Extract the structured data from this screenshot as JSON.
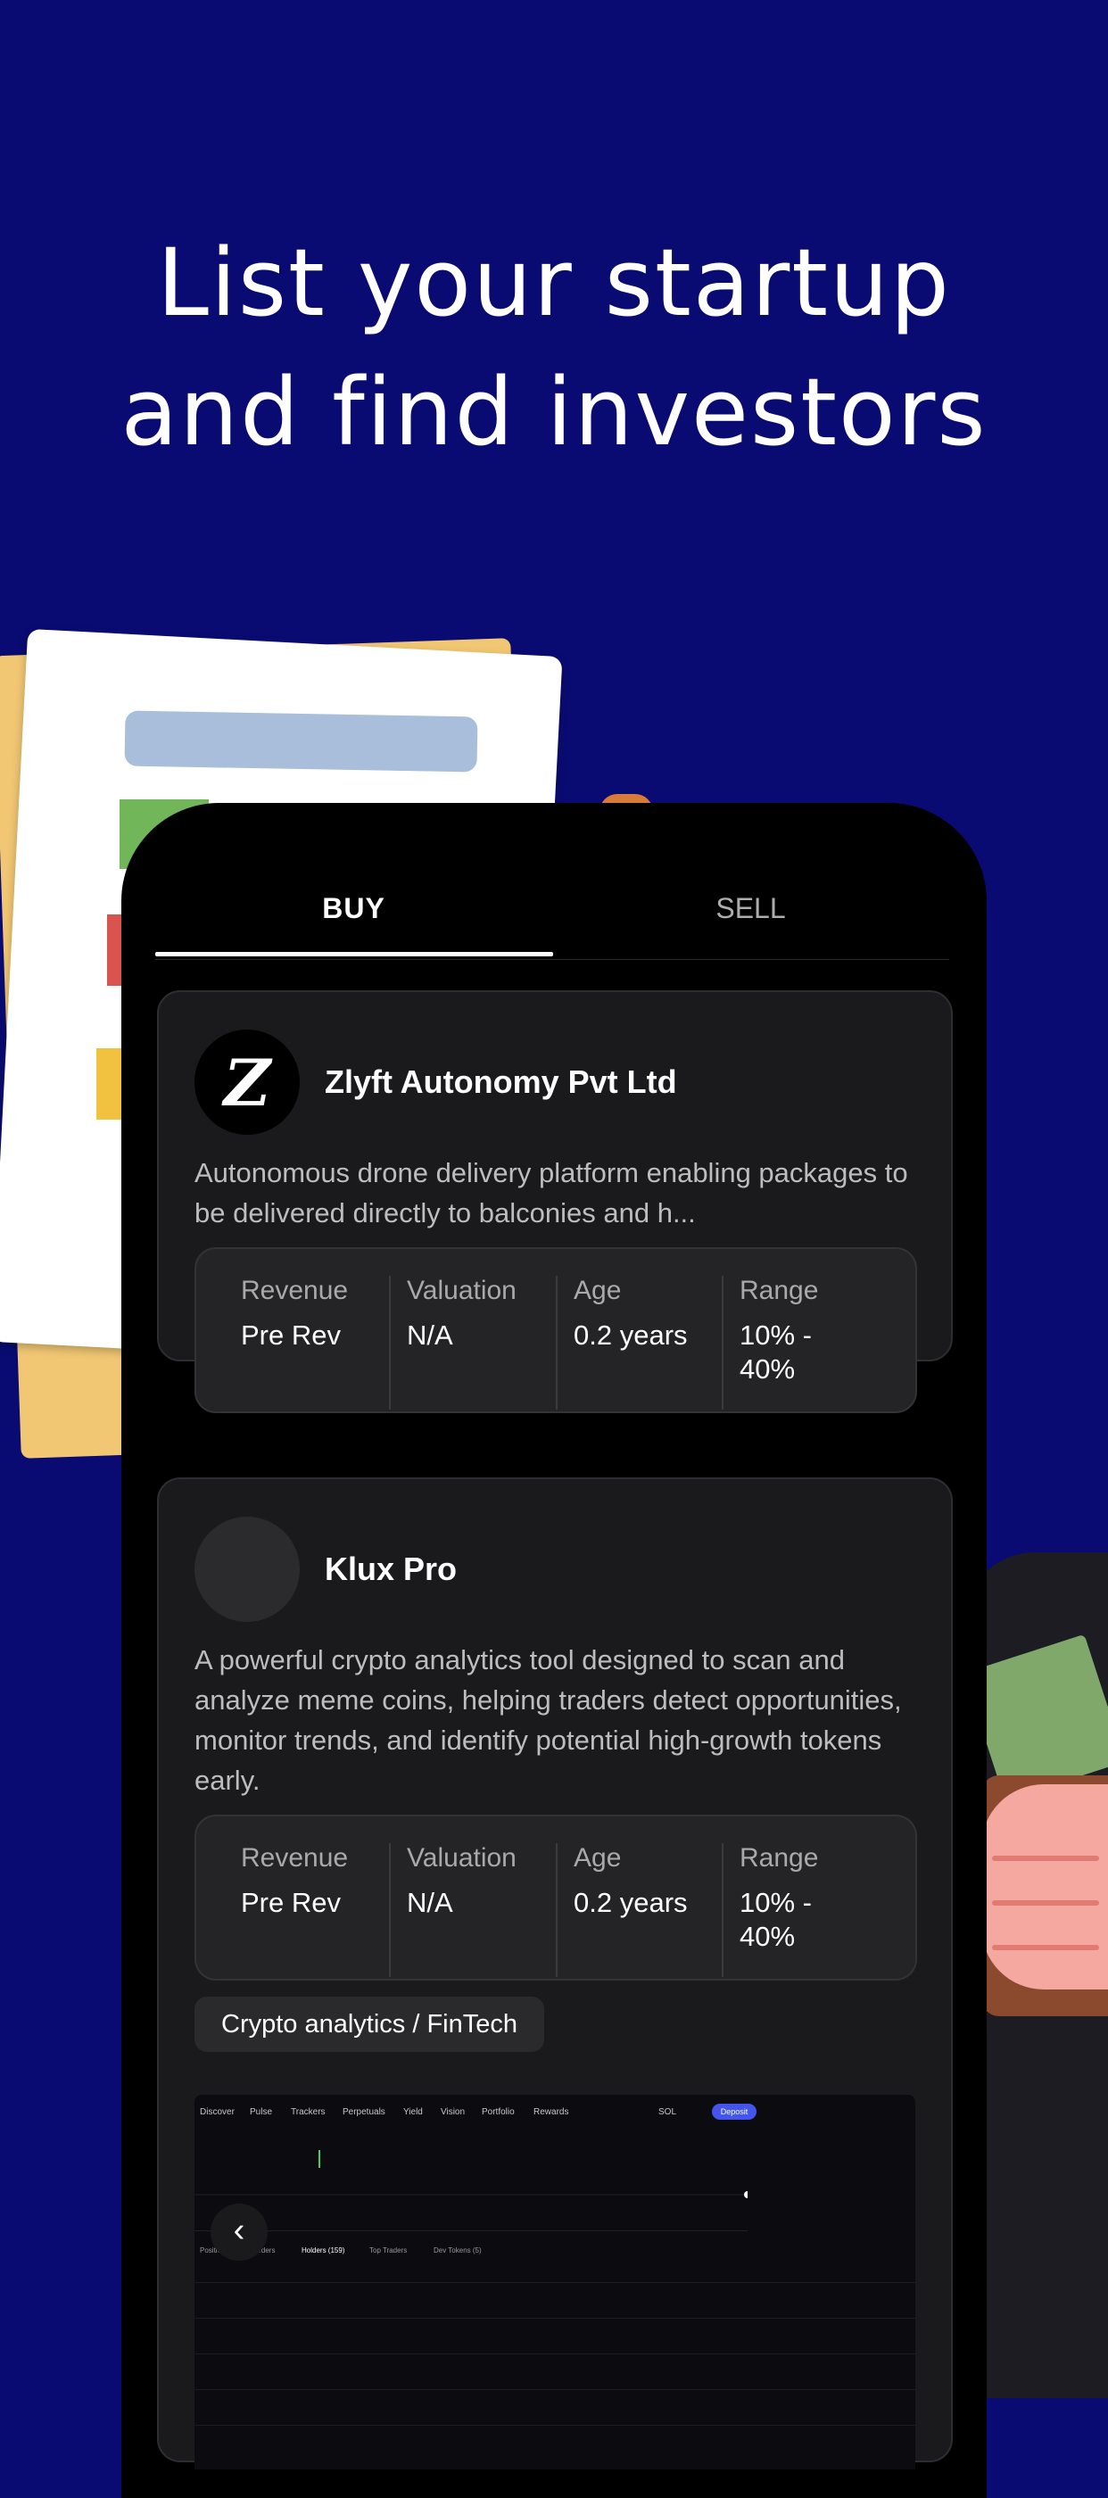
{
  "headline": {
    "line1": "List your startup",
    "line2": "and find investors"
  },
  "tabs": {
    "buy": "BUY",
    "sell": "SELL"
  },
  "listings": [
    {
      "name": "Zlyft Autonomy Pvt Ltd",
      "logo_letter": "Z",
      "description": "Autonomous drone delivery platform enabling packages to be delivered directly to balconies and h...",
      "metrics": {
        "revenue_label": "Revenue",
        "revenue": "Pre Rev",
        "valuation_label": "Valuation",
        "valuation": "N/A",
        "age_label": "Age",
        "age": "0.2 years",
        "range_label": "Range",
        "range": "10% - 40%"
      }
    },
    {
      "name": "Klux Pro",
      "description": "A powerful crypto analytics tool designed to scan and analyze meme coins, helping traders detect opportunities, monitor trends, and identify potential high-growth tokens early.",
      "metrics": {
        "revenue_label": "Revenue",
        "revenue": "Pre Rev",
        "valuation_label": "Valuation",
        "valuation": "N/A",
        "age_label": "Age",
        "age": "0.2 years",
        "range_label": "Range",
        "range": "10% - 40%"
      },
      "tag": "Crypto analytics / FinTech",
      "screenshot": {
        "nav": [
          "Discover",
          "Pulse",
          "Trackers",
          "Perpetuals",
          "Yield",
          "Vision",
          "Portfolio",
          "Rewards"
        ],
        "currency": "SOL",
        "deposit": "Deposit",
        "tabs": [
          "Positions",
          "Orders",
          "Holders (159)",
          "Top Traders",
          "Dev Tokens (5)"
        ]
      }
    }
  ],
  "back_button": "‹"
}
